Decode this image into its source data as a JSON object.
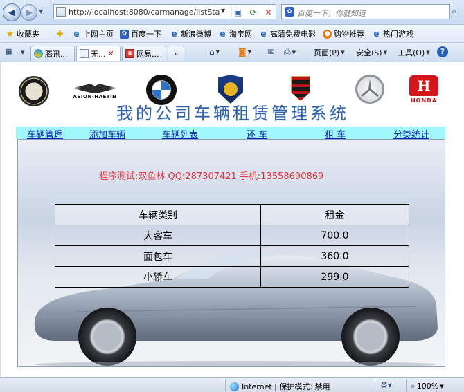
{
  "browser": {
    "url": "http://localhost:8080/carmanage/listSta",
    "search_placeholder": "百度一下，你就知道",
    "favorites": {
      "label": "收藏夹",
      "items": [
        "上网主页",
        "百度一下",
        "新浪微博",
        "淘宝网",
        "高清免费电影",
        "购物推荐",
        "热门游戏"
      ]
    },
    "tabs": [
      {
        "label": "腾讯..."
      },
      {
        "label": "无..."
      },
      {
        "label": "网易..."
      }
    ],
    "tab_more": "»",
    "commands": {
      "page": "页面(P)",
      "safety": "安全(S)",
      "tools": "工具(O)",
      "help": "?"
    }
  },
  "page": {
    "logos": {
      "aston_text": "ASION-HAETIN",
      "honda_letter": "H",
      "honda_text": "HONDA"
    },
    "title": "我的公司车辆租赁管理系统",
    "menu": [
      "车辆管理",
      "添加车辆",
      "车辆列表",
      "还 车",
      "租 车",
      "分类统计"
    ],
    "credit": "程序测试:双鱼林  QQ:287307421  手机:13558690869",
    "table": {
      "headers": [
        "车辆类别",
        "租金"
      ],
      "rows": [
        [
          "大客车",
          "700.0"
        ],
        [
          "面包车",
          "360.0"
        ],
        [
          "小轿车",
          "299.0"
        ]
      ]
    }
  },
  "status": {
    "zone": "Internet | 保护模式: 禁用",
    "zoom": "100%"
  }
}
